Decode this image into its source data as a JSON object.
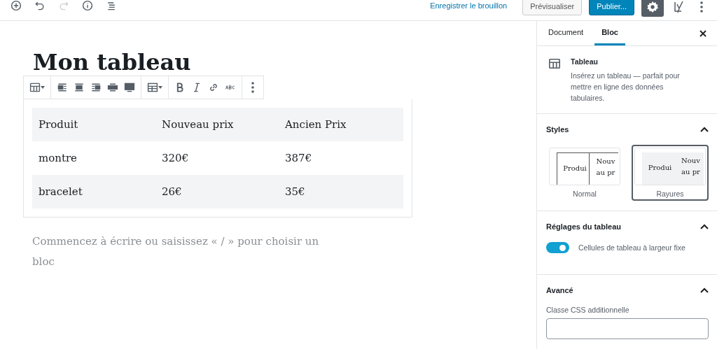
{
  "top_bar": {
    "left_tools": [
      {
        "kind": "add",
        "disabled": false
      },
      {
        "kind": "undo",
        "disabled": false
      },
      {
        "kind": "redo",
        "disabled": true
      },
      {
        "kind": "info",
        "disabled": false
      },
      {
        "kind": "outline",
        "disabled": false
      }
    ],
    "save_draft": "Enregistrer le brouillon",
    "preview": "Prévisualiser",
    "publish": "Publier...",
    "settings_active": true
  },
  "editor": {
    "title": "Mon tableau",
    "toolbar": [
      [
        {
          "kind": "table",
          "has_menu": true
        }
      ],
      [
        {
          "kind": "align-left",
          "has_menu": false
        },
        {
          "kind": "align-center",
          "has_menu": false
        },
        {
          "kind": "align-right",
          "has_menu": false
        },
        {
          "kind": "align-wide",
          "has_menu": false
        },
        {
          "kind": "align-full",
          "has_menu": false
        }
      ],
      [
        {
          "kind": "table-edit",
          "has_menu": true
        }
      ],
      [
        {
          "kind": "bold",
          "has_menu": false
        },
        {
          "kind": "italic",
          "has_menu": false
        },
        {
          "kind": "link",
          "has_menu": false
        },
        {
          "kind": "strike",
          "has_menu": false
        }
      ],
      [
        {
          "kind": "more",
          "has_menu": false
        }
      ]
    ],
    "table": {
      "striped": true,
      "rows": [
        [
          "Produit",
          "Nouveau prix",
          "Ancien Prix"
        ],
        [
          "montre",
          "320€",
          "387€"
        ],
        [
          "bracelet",
          "26€",
          "35€"
        ]
      ]
    },
    "placeholder": "Commencez à écrire ou saisissez « / » pour choisir un bloc"
  },
  "sidebar": {
    "tabs": [
      {
        "label": "Document",
        "selected": false
      },
      {
        "label": "Bloc",
        "selected": true
      }
    ],
    "block": {
      "name": "Tableau",
      "description": "Insérez un tableau — parfait pour mettre en ligne des données tabulaires."
    },
    "styles": {
      "title": "Styles",
      "expanded": true,
      "options": [
        {
          "label": "Normal",
          "selected": false,
          "striped": false,
          "cells": [
            "Produi",
            "Nouv",
            "au pr"
          ]
        },
        {
          "label": "Rayures",
          "selected": true,
          "striped": true,
          "cells": [
            "Produi",
            "Nouv",
            "au pr"
          ]
        }
      ]
    },
    "table_settings": {
      "title": "Réglages du tableau",
      "expanded": true,
      "toggle": {
        "label": "Cellules de tableau à largeur fixe",
        "on": true
      }
    },
    "advanced": {
      "title": "Avancé",
      "expanded": true,
      "field_label": "Classe CSS additionnelle"
    }
  }
}
